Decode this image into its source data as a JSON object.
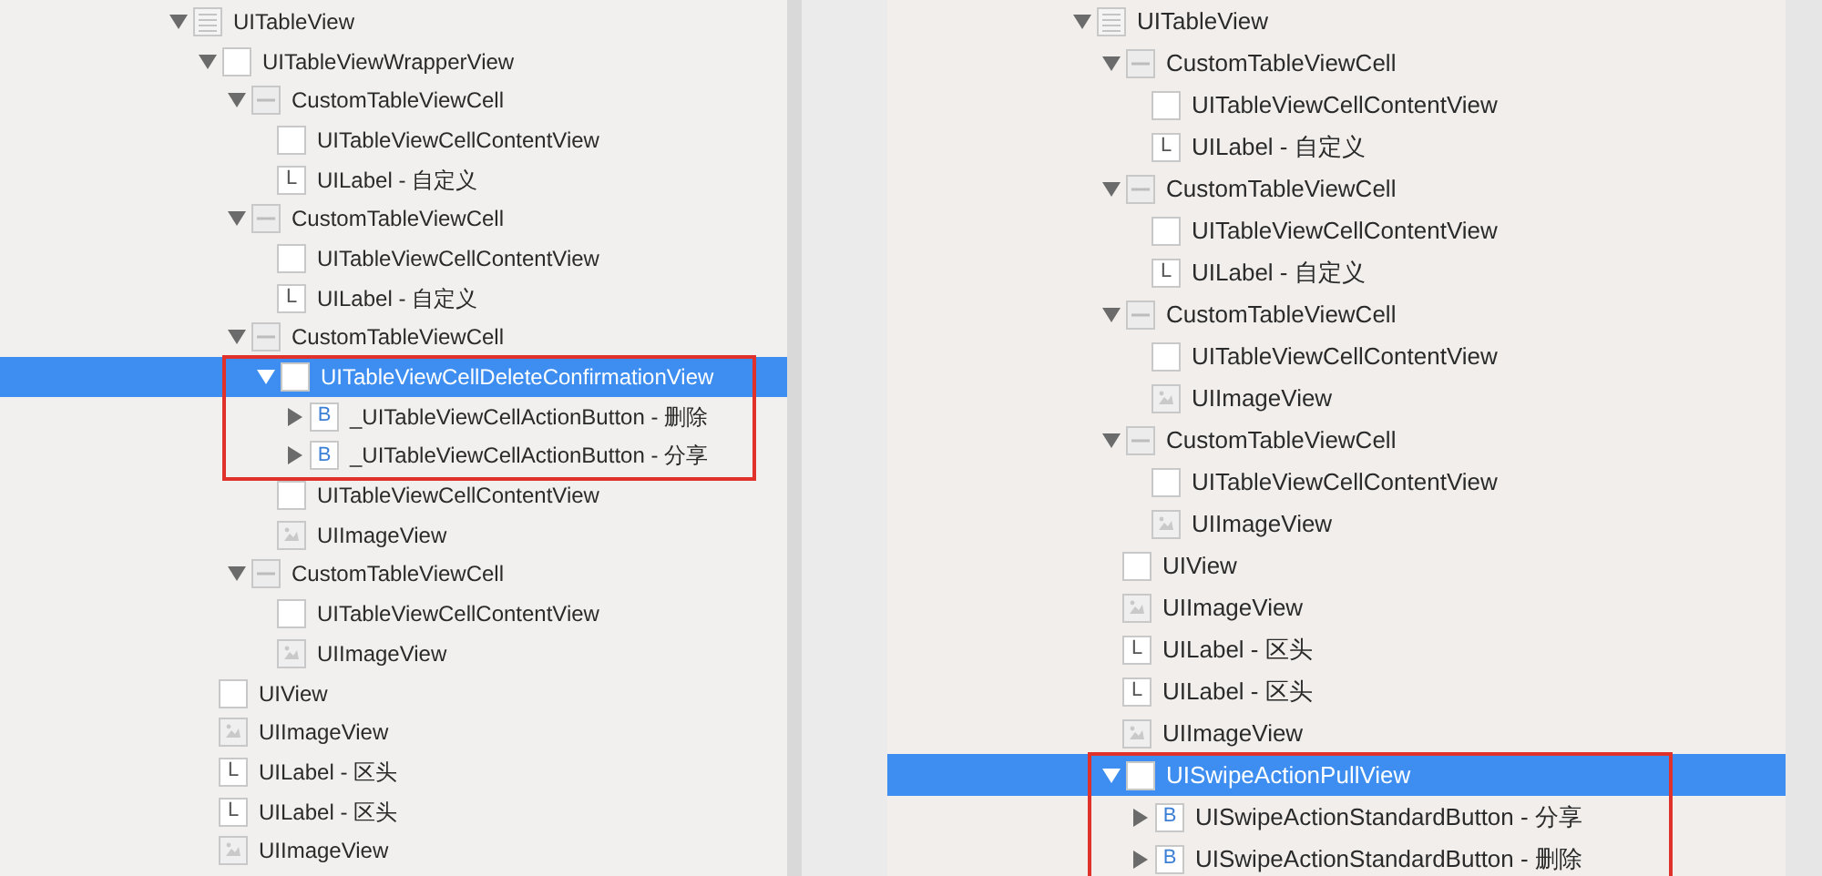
{
  "panels": [
    {
      "tree": [
        {
          "label": "UITableView",
          "kind": "list",
          "expanded": true,
          "selected": false,
          "children": [
            {
              "label": "UITableViewWrapperView",
              "kind": "view",
              "expanded": true,
              "selected": false,
              "children": [
                {
                  "label": "CustomTableViewCell",
                  "kind": "cell",
                  "expanded": true,
                  "selected": false,
                  "children": [
                    {
                      "label": "UITableViewCellContentView",
                      "kind": "view",
                      "selected": false
                    },
                    {
                      "label": "UILabel - 自定义",
                      "kind": "label",
                      "badge": "L",
                      "selected": false
                    }
                  ]
                },
                {
                  "label": "CustomTableViewCell",
                  "kind": "cell",
                  "expanded": true,
                  "selected": false,
                  "children": [
                    {
                      "label": "UITableViewCellContentView",
                      "kind": "view",
                      "selected": false
                    },
                    {
                      "label": "UILabel - 自定义",
                      "kind": "label",
                      "badge": "L",
                      "selected": false
                    }
                  ]
                },
                {
                  "label": "CustomTableViewCell",
                  "kind": "cell",
                  "expanded": true,
                  "selected": false,
                  "children": [
                    {
                      "label": "UITableViewCellDeleteConfirmationView",
                      "kind": "view",
                      "expanded": true,
                      "selected": true,
                      "outlined": true,
                      "children": [
                        {
                          "label": "_UITableViewCellActionButton - 删除",
                          "kind": "button",
                          "badge": "B",
                          "expanded": false,
                          "selected": false
                        },
                        {
                          "label": "_UITableViewCellActionButton - 分享",
                          "kind": "button",
                          "badge": "B",
                          "expanded": false,
                          "selected": false
                        }
                      ]
                    },
                    {
                      "label": "UITableViewCellContentView",
                      "kind": "view",
                      "selected": false
                    },
                    {
                      "label": "UIImageView",
                      "kind": "image",
                      "selected": false
                    }
                  ]
                },
                {
                  "label": "CustomTableViewCell",
                  "kind": "cell",
                  "expanded": true,
                  "selected": false,
                  "children": [
                    {
                      "label": "UITableViewCellContentView",
                      "kind": "view",
                      "selected": false
                    },
                    {
                      "label": "UIImageView",
                      "kind": "image",
                      "selected": false
                    }
                  ]
                }
              ]
            },
            {
              "label": "UIView",
              "kind": "view",
              "selected": false
            },
            {
              "label": "UIImageView",
              "kind": "image",
              "selected": false
            },
            {
              "label": "UILabel - 区头",
              "kind": "label",
              "badge": "L",
              "selected": false
            },
            {
              "label": "UILabel - 区头",
              "kind": "label",
              "badge": "L",
              "selected": false
            },
            {
              "label": "UIImageView",
              "kind": "image",
              "selected": false
            }
          ]
        }
      ]
    },
    {
      "tree": [
        {
          "label": "UITableView",
          "kind": "list",
          "expanded": true,
          "selected": false,
          "children": [
            {
              "label": "CustomTableViewCell",
              "kind": "cell",
              "expanded": true,
              "selected": false,
              "children": [
                {
                  "label": "UITableViewCellContentView",
                  "kind": "view",
                  "selected": false
                },
                {
                  "label": "UILabel - 自定义",
                  "kind": "label",
                  "badge": "L",
                  "selected": false
                }
              ]
            },
            {
              "label": "CustomTableViewCell",
              "kind": "cell",
              "expanded": true,
              "selected": false,
              "children": [
                {
                  "label": "UITableViewCellContentView",
                  "kind": "view",
                  "selected": false
                },
                {
                  "label": "UILabel - 自定义",
                  "kind": "label",
                  "badge": "L",
                  "selected": false
                }
              ]
            },
            {
              "label": "CustomTableViewCell",
              "kind": "cell",
              "expanded": true,
              "selected": false,
              "children": [
                {
                  "label": "UITableViewCellContentView",
                  "kind": "view",
                  "selected": false
                },
                {
                  "label": "UIImageView",
                  "kind": "image",
                  "selected": false
                }
              ]
            },
            {
              "label": "CustomTableViewCell",
              "kind": "cell",
              "expanded": true,
              "selected": false,
              "children": [
                {
                  "label": "UITableViewCellContentView",
                  "kind": "view",
                  "selected": false
                },
                {
                  "label": "UIImageView",
                  "kind": "image",
                  "selected": false
                }
              ]
            },
            {
              "label": "UIView",
              "kind": "view",
              "selected": false
            },
            {
              "label": "UIImageView",
              "kind": "image",
              "selected": false
            },
            {
              "label": "UILabel - 区头",
              "kind": "label",
              "badge": "L",
              "selected": false
            },
            {
              "label": "UILabel - 区头",
              "kind": "label",
              "badge": "L",
              "selected": false
            },
            {
              "label": "UIImageView",
              "kind": "image",
              "selected": false
            },
            {
              "label": "UISwipeActionPullView",
              "kind": "view",
              "expanded": true,
              "selected": true,
              "outlined": true,
              "children": [
                {
                  "label": "UISwipeActionStandardButton - 分享",
                  "kind": "button",
                  "badge": "B",
                  "expanded": false,
                  "selected": false
                },
                {
                  "label": "UISwipeActionStandardButton - 删除",
                  "kind": "button",
                  "badge": "B",
                  "expanded": false,
                  "selected": false
                }
              ]
            }
          ]
        }
      ]
    }
  ]
}
